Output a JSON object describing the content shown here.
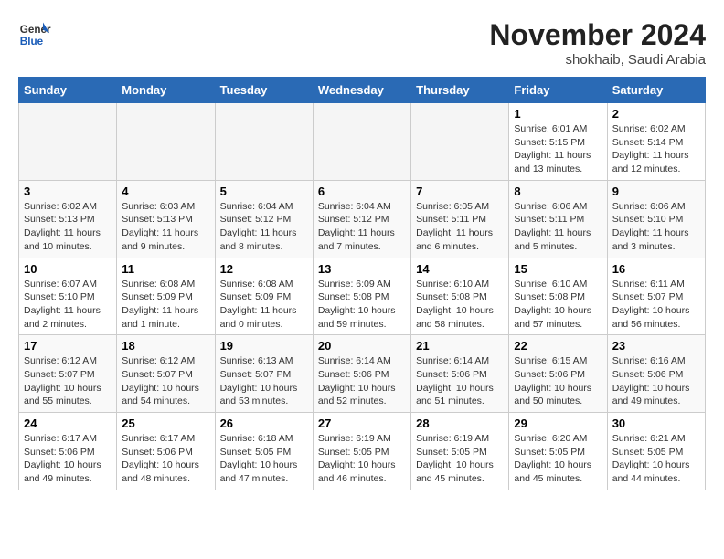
{
  "header": {
    "logo_line1": "General",
    "logo_line2": "Blue",
    "month": "November 2024",
    "location": "shokhaib, Saudi Arabia"
  },
  "weekdays": [
    "Sunday",
    "Monday",
    "Tuesday",
    "Wednesday",
    "Thursday",
    "Friday",
    "Saturday"
  ],
  "weeks": [
    [
      {
        "day": "",
        "info": ""
      },
      {
        "day": "",
        "info": ""
      },
      {
        "day": "",
        "info": ""
      },
      {
        "day": "",
        "info": ""
      },
      {
        "day": "",
        "info": ""
      },
      {
        "day": "1",
        "info": "Sunrise: 6:01 AM\nSunset: 5:15 PM\nDaylight: 11 hours and 13 minutes."
      },
      {
        "day": "2",
        "info": "Sunrise: 6:02 AM\nSunset: 5:14 PM\nDaylight: 11 hours and 12 minutes."
      }
    ],
    [
      {
        "day": "3",
        "info": "Sunrise: 6:02 AM\nSunset: 5:13 PM\nDaylight: 11 hours and 10 minutes."
      },
      {
        "day": "4",
        "info": "Sunrise: 6:03 AM\nSunset: 5:13 PM\nDaylight: 11 hours and 9 minutes."
      },
      {
        "day": "5",
        "info": "Sunrise: 6:04 AM\nSunset: 5:12 PM\nDaylight: 11 hours and 8 minutes."
      },
      {
        "day": "6",
        "info": "Sunrise: 6:04 AM\nSunset: 5:12 PM\nDaylight: 11 hours and 7 minutes."
      },
      {
        "day": "7",
        "info": "Sunrise: 6:05 AM\nSunset: 5:11 PM\nDaylight: 11 hours and 6 minutes."
      },
      {
        "day": "8",
        "info": "Sunrise: 6:06 AM\nSunset: 5:11 PM\nDaylight: 11 hours and 5 minutes."
      },
      {
        "day": "9",
        "info": "Sunrise: 6:06 AM\nSunset: 5:10 PM\nDaylight: 11 hours and 3 minutes."
      }
    ],
    [
      {
        "day": "10",
        "info": "Sunrise: 6:07 AM\nSunset: 5:10 PM\nDaylight: 11 hours and 2 minutes."
      },
      {
        "day": "11",
        "info": "Sunrise: 6:08 AM\nSunset: 5:09 PM\nDaylight: 11 hours and 1 minute."
      },
      {
        "day": "12",
        "info": "Sunrise: 6:08 AM\nSunset: 5:09 PM\nDaylight: 11 hours and 0 minutes."
      },
      {
        "day": "13",
        "info": "Sunrise: 6:09 AM\nSunset: 5:08 PM\nDaylight: 10 hours and 59 minutes."
      },
      {
        "day": "14",
        "info": "Sunrise: 6:10 AM\nSunset: 5:08 PM\nDaylight: 10 hours and 58 minutes."
      },
      {
        "day": "15",
        "info": "Sunrise: 6:10 AM\nSunset: 5:08 PM\nDaylight: 10 hours and 57 minutes."
      },
      {
        "day": "16",
        "info": "Sunrise: 6:11 AM\nSunset: 5:07 PM\nDaylight: 10 hours and 56 minutes."
      }
    ],
    [
      {
        "day": "17",
        "info": "Sunrise: 6:12 AM\nSunset: 5:07 PM\nDaylight: 10 hours and 55 minutes."
      },
      {
        "day": "18",
        "info": "Sunrise: 6:12 AM\nSunset: 5:07 PM\nDaylight: 10 hours and 54 minutes."
      },
      {
        "day": "19",
        "info": "Sunrise: 6:13 AM\nSunset: 5:07 PM\nDaylight: 10 hours and 53 minutes."
      },
      {
        "day": "20",
        "info": "Sunrise: 6:14 AM\nSunset: 5:06 PM\nDaylight: 10 hours and 52 minutes."
      },
      {
        "day": "21",
        "info": "Sunrise: 6:14 AM\nSunset: 5:06 PM\nDaylight: 10 hours and 51 minutes."
      },
      {
        "day": "22",
        "info": "Sunrise: 6:15 AM\nSunset: 5:06 PM\nDaylight: 10 hours and 50 minutes."
      },
      {
        "day": "23",
        "info": "Sunrise: 6:16 AM\nSunset: 5:06 PM\nDaylight: 10 hours and 49 minutes."
      }
    ],
    [
      {
        "day": "24",
        "info": "Sunrise: 6:17 AM\nSunset: 5:06 PM\nDaylight: 10 hours and 49 minutes."
      },
      {
        "day": "25",
        "info": "Sunrise: 6:17 AM\nSunset: 5:06 PM\nDaylight: 10 hours and 48 minutes."
      },
      {
        "day": "26",
        "info": "Sunrise: 6:18 AM\nSunset: 5:05 PM\nDaylight: 10 hours and 47 minutes."
      },
      {
        "day": "27",
        "info": "Sunrise: 6:19 AM\nSunset: 5:05 PM\nDaylight: 10 hours and 46 minutes."
      },
      {
        "day": "28",
        "info": "Sunrise: 6:19 AM\nSunset: 5:05 PM\nDaylight: 10 hours and 45 minutes."
      },
      {
        "day": "29",
        "info": "Sunrise: 6:20 AM\nSunset: 5:05 PM\nDaylight: 10 hours and 45 minutes."
      },
      {
        "day": "30",
        "info": "Sunrise: 6:21 AM\nSunset: 5:05 PM\nDaylight: 10 hours and 44 minutes."
      }
    ]
  ]
}
